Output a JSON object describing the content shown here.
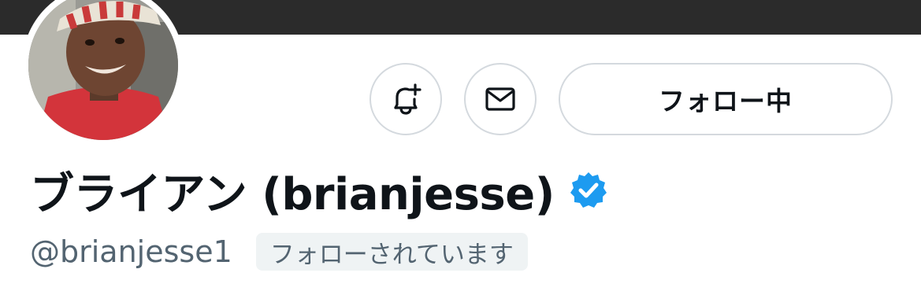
{
  "profile": {
    "display_name": "ブライアン (brianjesse)",
    "handle": "@brianjesse1",
    "follows_you_label": "フォローされています",
    "verified": true
  },
  "actions": {
    "notify_icon": "bell-plus-icon",
    "message_icon": "envelope-icon",
    "follow_label": "フォロー中"
  },
  "colors": {
    "banner": "#2b2b2b",
    "verified_badge": "#1d9bf0",
    "text_primary": "#0f1419",
    "text_secondary": "#536471",
    "button_border": "#d4d9de",
    "badge_bg": "#eff3f4"
  }
}
